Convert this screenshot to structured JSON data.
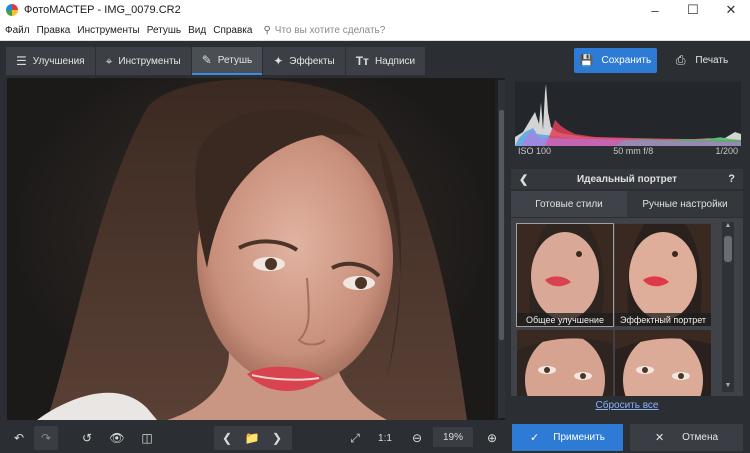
{
  "window": {
    "title": "ФотоМАСТЕР - IMG_0079.CR2",
    "minimize_icon": "minimize-icon",
    "maximize_icon": "maximize-icon",
    "close_icon": "close-icon"
  },
  "menu": {
    "items": [
      "Файл",
      "Правка",
      "Инструменты",
      "Ретушь",
      "Вид",
      "Справка"
    ],
    "search_placeholder": "Что вы хотите сделать?"
  },
  "toolbar": {
    "tabs": [
      {
        "label": "Улучшения",
        "icon": "sliders-icon"
      },
      {
        "label": "Инструменты",
        "icon": "crop-icon"
      },
      {
        "label": "Ретушь",
        "icon": "brush-icon",
        "active": true
      },
      {
        "label": "Эффекты",
        "icon": "magic-wand-icon"
      },
      {
        "label": "Надписи",
        "icon": "text-icon"
      }
    ],
    "save_label": "Сохранить",
    "print_label": "Печать"
  },
  "histogram": {
    "iso": "ISO 100",
    "lens": "50 mm f/8",
    "shutter": "1/200"
  },
  "panel": {
    "title": "Идеальный портрет",
    "subtabs": [
      "Готовые стили",
      "Ручные настройки"
    ],
    "styles": [
      "Общее улучшение",
      "Эффектный портрет"
    ],
    "reset_label": "Сбросить все"
  },
  "bottom": {
    "zoom": "19%",
    "fit_label": "1:1",
    "apply_label": "Применить",
    "cancel_label": "Отмена"
  },
  "colors": {
    "accent": "#2e7bd6",
    "background": "#2b2e33",
    "panel": "#3f4349"
  }
}
